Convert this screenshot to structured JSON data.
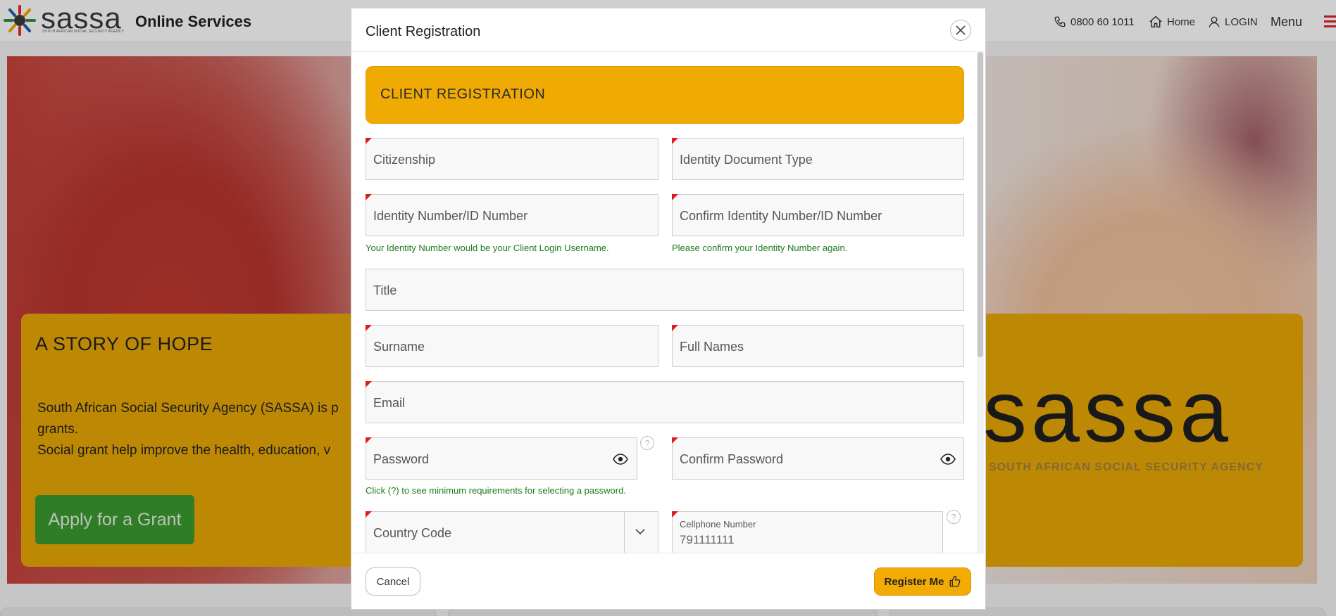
{
  "header": {
    "logo_word": "sassa",
    "logo_sub": "SOUTH AFRICAN SOCIAL SECURITY AGENCY",
    "site_title": "Online Services",
    "phone": "0800 60 1011",
    "home_label": "Home",
    "login_label": "LOGIN",
    "menu_label": "Menu"
  },
  "hero": {
    "story_title": "A STORY OF HOPE",
    "story_line1": "South African Social Security Agency (SASSA) is p",
    "story_line2": "grants.",
    "story_line3": "Social grant help improve the health, education, v",
    "apply_label": "Apply for a Grant",
    "big_logo": "sassa",
    "big_logo_sub": "SOUTH AFRICAN SOCIAL SECURITY AGENCY"
  },
  "modal": {
    "title": "Client Registration",
    "banner": "CLIENT REGISTRATION",
    "fields": {
      "citizenship": "Citizenship",
      "id_doc_type": "Identity Document Type",
      "id_number": "Identity Number/ID Number",
      "confirm_id": "Confirm Identity Number/ID Number",
      "title": "Title",
      "surname": "Surname",
      "full_names": "Full Names",
      "email": "Email",
      "password": "Password",
      "confirm_password": "Confirm Password",
      "country_code": "Country Code",
      "cellphone_label": "Cellphone Number",
      "cellphone_value": "791111111"
    },
    "hints": {
      "id_number": "Your Identity Number would be your Client Login Username.",
      "confirm_id": "Please confirm your Identity Number again.",
      "password": "Click (?) to see minimum requirements for selecting a password."
    },
    "help_glyph": "?",
    "cancel_label": "Cancel",
    "register_label": "Register Me"
  },
  "colors": {
    "accent": "#f0aa04",
    "required_marker": "#e01b1b",
    "hint_text": "#1e7b1e",
    "apply_button": "#3b9a2f"
  }
}
